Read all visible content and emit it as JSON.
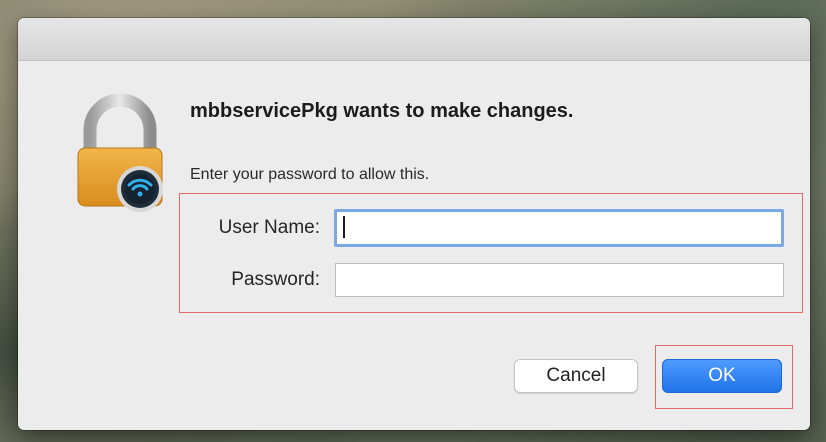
{
  "dialog": {
    "title": "mbbservicePkg wants to make changes.",
    "subtitle": "Enter your password to allow this.",
    "icon": "lock-icon",
    "fields": {
      "user_label": "User Name:",
      "user_value": "",
      "password_label": "Password:",
      "password_value": ""
    },
    "buttons": {
      "cancel": "Cancel",
      "ok": "OK"
    }
  },
  "colors": {
    "primary_button": "#1f72e8",
    "focus_ring": "#7aa7e6",
    "highlight_outline": "#e06a6a"
  }
}
